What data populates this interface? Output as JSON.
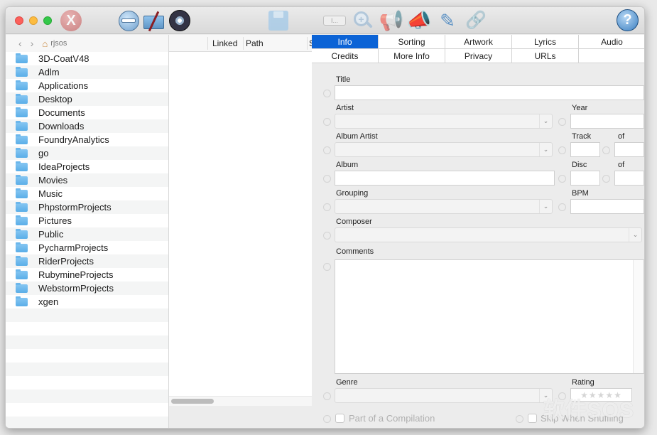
{
  "toolbar": {
    "buttons": [
      {
        "name": "remove-tags-button",
        "icon": "circle-x-icon",
        "glyph": "X"
      },
      {
        "name": "remove-button",
        "icon": "circle-minus-icon"
      },
      {
        "name": "unlink-folder-button",
        "icon": "folder-slash-icon"
      },
      {
        "name": "disc-button",
        "icon": "disc-icon"
      },
      {
        "name": "save-button",
        "icon": "floppy-icon"
      },
      {
        "name": "tag-button",
        "icon": "tag-box-icon",
        "glyph": "I..."
      },
      {
        "name": "zoom-button",
        "icon": "magnify-plus-icon",
        "glyph": "+"
      },
      {
        "name": "announce-button",
        "icon": "megaphone-icon",
        "glyph": "📢"
      },
      {
        "name": "edit-announce-button",
        "icon": "megaphone-edit-icon",
        "glyph": "📣"
      },
      {
        "name": "edit-button",
        "icon": "pencil-icon",
        "glyph": "✎"
      },
      {
        "name": "link-button",
        "icon": "link-icon",
        "glyph": "🔗"
      }
    ],
    "help_glyph": "?"
  },
  "browser": {
    "back_glyph": "‹",
    "forward_glyph": "›",
    "home_glyph": "⌂",
    "location": "rjsos",
    "folders": [
      "3D-CoatV48",
      "Adlm",
      "Applications",
      "Desktop",
      "Documents",
      "Downloads",
      "FoundryAnalytics",
      "go",
      "IdeaProjects",
      "Movies",
      "Music",
      "PhpstormProjects",
      "Pictures",
      "Public",
      "PycharmProjects",
      "RiderProjects",
      "RubymineProjects",
      "WebstormProjects",
      "xgen"
    ]
  },
  "table": {
    "columns": [
      "Linked",
      "Path",
      "S"
    ]
  },
  "panel": {
    "tabs_row1": [
      "Info",
      "Sorting",
      "Artwork",
      "Lyrics",
      "Audio"
    ],
    "tabs_row2": [
      "Credits",
      "More Info",
      "Privacy",
      "URLs"
    ],
    "active_tab": "Info",
    "labels": {
      "title": "Title",
      "artist": "Artist",
      "year": "Year",
      "album_artist": "Album Artist",
      "track": "Track",
      "track_of": "of",
      "album": "Album",
      "disc": "Disc",
      "disc_of": "of",
      "grouping": "Grouping",
      "bpm": "BPM",
      "composer": "Composer",
      "comments": "Comments",
      "genre": "Genre",
      "rating": "Rating",
      "compilation": "Part of a Compilation",
      "skip_shuffle": "Skip When Shuffling"
    },
    "values": {
      "title": "",
      "artist": "",
      "year": "",
      "album_artist": "",
      "track": "",
      "track_of": "",
      "album": "",
      "disc": "",
      "disc_of": "",
      "grouping": "",
      "bpm": "",
      "composer": "",
      "comments": "",
      "genre": ""
    },
    "rating_stars": "★★★★★",
    "rating_value": 0,
    "compilation_checked": false,
    "skip_shuffle_checked": false,
    "chevron_glyph": "⌄"
  },
  "watermark": "软件SOS"
}
